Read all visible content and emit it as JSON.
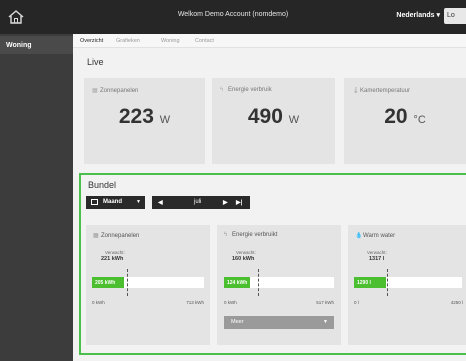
{
  "header": {
    "title": "Welkom Demo Account (nomdemo)",
    "language": "Nederlands ▾",
    "login_label": "Lo"
  },
  "sidebar": {
    "items": [
      {
        "label": "Woning"
      }
    ]
  },
  "tabs": [
    {
      "label": "Overzicht",
      "active": true
    },
    {
      "label": "Grafieken",
      "active": false
    },
    {
      "label": "Woning",
      "active": false
    },
    {
      "label": "Contact",
      "active": false
    }
  ],
  "live": {
    "title": "Live",
    "cards": [
      {
        "label": "Zonnepanelen",
        "value": "223",
        "unit": "W",
        "icon": "solar-panel-icon"
      },
      {
        "label": "Energie verbruik",
        "value": "490",
        "unit": "W",
        "icon": "lightning-icon"
      },
      {
        "label": "Kamertemperatuur",
        "value": "20",
        "unit": "°C",
        "icon": "thermometer-icon"
      }
    ]
  },
  "bundel": {
    "title": "Bundel",
    "period_select": "Maand",
    "month": "juli",
    "cards": [
      {
        "label": "Zonnepanelen",
        "icon": "solar-panel-icon",
        "expected_label": "Verwacht:",
        "expected": "221 kWh",
        "bar_label": "205 kWh",
        "fill": 0.29,
        "marker": 0.31,
        "min": "0 kWh",
        "max": "713 kWh"
      },
      {
        "label": "Energie verbruikt",
        "icon": "lightning-icon",
        "expected_label": "Verwacht:",
        "expected": "160 kWh",
        "bar_label": "124 kWh",
        "fill": 0.24,
        "marker": 0.31,
        "min": "0 kWh",
        "max": "517 kWh",
        "more": "Meer"
      },
      {
        "label": "Warm water",
        "icon": "water-drop-icon",
        "expected_label": "Verwacht:",
        "expected": "1317 l",
        "bar_label": "1290 l",
        "fill": 0.3,
        "marker": 0.31,
        "min": "0 l",
        "max": "4250 l"
      }
    ]
  },
  "colors": {
    "accent_green": "#4bbf2f",
    "bundel_border": "#4bbf4b",
    "topbar": "#262626"
  }
}
